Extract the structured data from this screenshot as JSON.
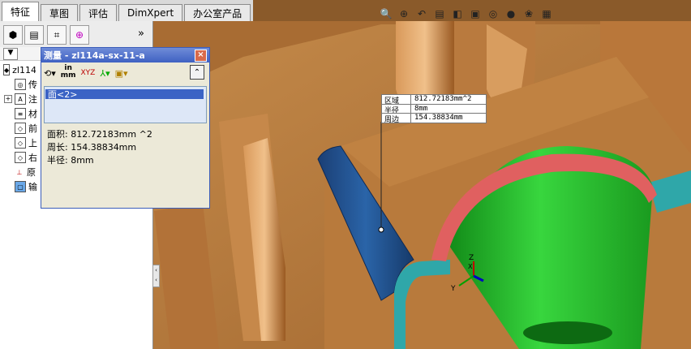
{
  "tabs": [
    "特征",
    "草图",
    "评估",
    "DimXpert",
    "办公室产品"
  ],
  "active_tab": "特征",
  "feature_tree": {
    "items": [
      {
        "label": "zl114",
        "icon": "part-icon"
      },
      {
        "label": "传",
        "icon": "sensor-icon"
      },
      {
        "label": "注",
        "icon": "annotation-icon"
      },
      {
        "label": "材",
        "icon": "material-icon"
      },
      {
        "label": "前",
        "icon": "plane-icon"
      },
      {
        "label": "上",
        "icon": "plane-icon"
      },
      {
        "label": "右",
        "icon": "plane-icon"
      },
      {
        "label": "原",
        "icon": "origin-icon"
      },
      {
        "label": "输",
        "icon": "imported-icon"
      }
    ],
    "collapse_label": "»"
  },
  "measure": {
    "title": "测量 - zl114a-sx-11-a",
    "close": "×",
    "tool_units_top": "in",
    "tool_units_bottom": "mm",
    "tool_xyz": "XYZ",
    "expand": "⌃",
    "selection": "面<2>",
    "results": {
      "area": "面积: 812.72183mm ^2",
      "perimeter": "周长: 154.38834mm",
      "radius": "半径:  8mm"
    }
  },
  "callout": {
    "rows": [
      {
        "label": "区域",
        "value": "812.72183mm^2"
      },
      {
        "label": "半径",
        "value": "8mm"
      },
      {
        "label": "周边",
        "value": "154.38834mm"
      }
    ]
  },
  "triad": {
    "x": "X",
    "y": "Y",
    "z": "Z"
  },
  "colors": {
    "model_base": "#b87a3c",
    "face_selected": "#1c4f8a",
    "fillet": "#2fa7a9",
    "cone": "#22b62a",
    "rim": "#e06060"
  }
}
